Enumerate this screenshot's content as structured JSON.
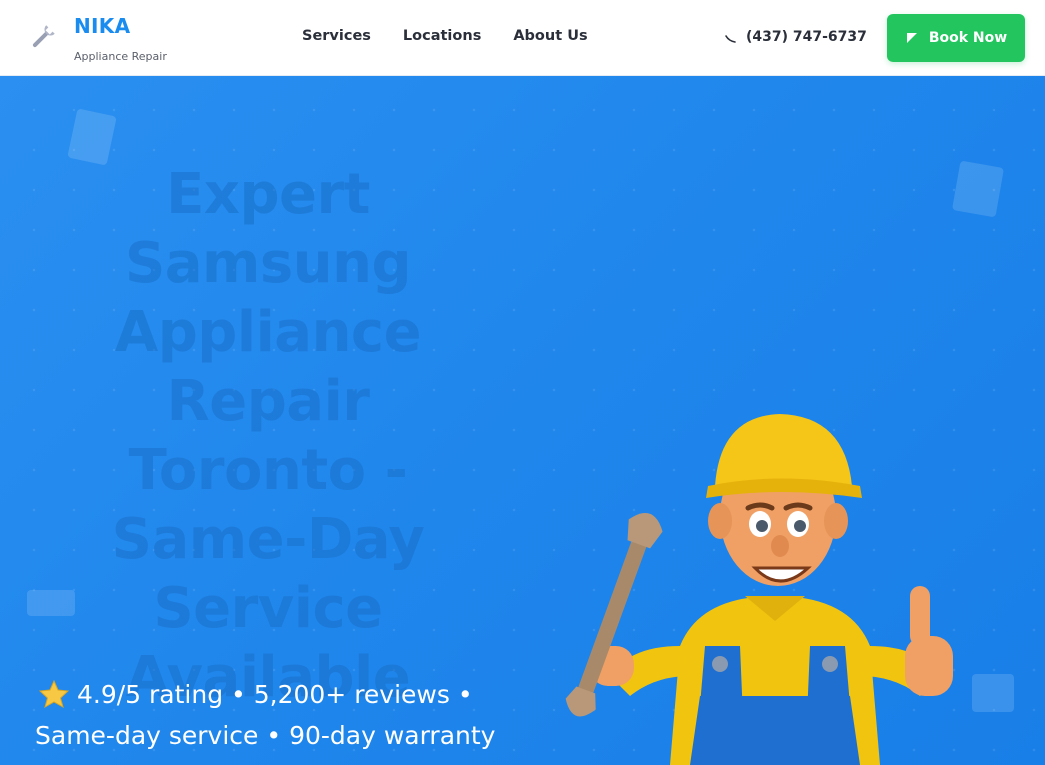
{
  "header": {
    "logo": {
      "name": "NIKA",
      "subtitle": "Appliance Repair",
      "icon": "wrench-icon"
    },
    "nav": [
      {
        "label": "Services"
      },
      {
        "label": "Locations"
      },
      {
        "label": "About Us"
      }
    ],
    "phone": {
      "icon": "phone-icon",
      "number": "(437) 747-6737"
    },
    "book_button": {
      "icon": "arrow-icon",
      "label": "Book Now"
    }
  },
  "hero": {
    "title": "Expert Samsung Appliance Repair Toronto - Same-Day Service Available",
    "rating_icon": "star-icon",
    "rating_line1": "4.9/5 rating • 5,200+ reviews •",
    "rating_line2": "Same-day service • 90-day warranty",
    "mascot": "repair-technician-illustration"
  },
  "colors": {
    "brand_blue": "#1a8cf0",
    "hero_bg": "#1f86ec",
    "cta_green": "#22c55e",
    "text_dark": "#2a2f3a"
  }
}
